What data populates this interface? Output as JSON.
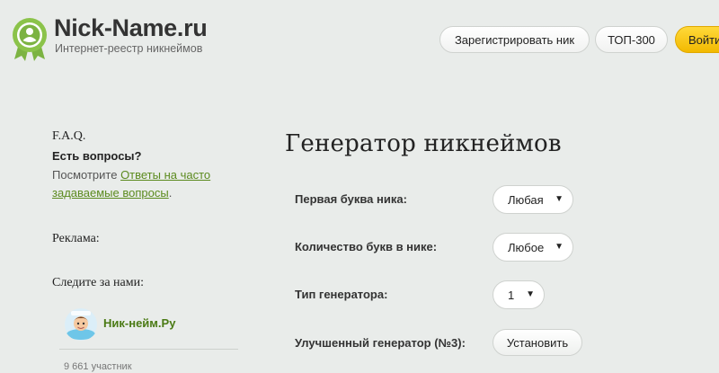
{
  "header": {
    "site_name": "Nick-Name.ru",
    "tagline": "Интернет-реестр никнеймов",
    "register_button": "Зарегистрировать ник",
    "top_button": "ТОП-300",
    "login_button": "Войти"
  },
  "sidebar": {
    "faq_title": "F.A.Q.",
    "faq_question": "Есть вопросы?",
    "faq_text_before": "Посмотрите ",
    "faq_link": "Ответы на часто задаваемые вопросы",
    "faq_text_after": ".",
    "ads_title": "Реклама:",
    "follow_title": "Следите за нами:",
    "group_name": "Ник-нейм.Ру",
    "member_count": "9 661 участник"
  },
  "main": {
    "title": "Генератор никнеймов",
    "fields": {
      "first_letter": {
        "label": "Первая буква ника:",
        "value": "Любая"
      },
      "letter_count": {
        "label": "Количество букв в нике:",
        "value": "Любое"
      },
      "generator_type": {
        "label": "Тип генератора:",
        "value": "1"
      },
      "improved": {
        "label": "Улучшенный генератор (№3):",
        "button": "Установить"
      }
    }
  },
  "colors": {
    "background": "#e9ecea",
    "link": "#5b8a1e",
    "logo_green": "#7cb342",
    "login_yellow": "#f6c400"
  }
}
